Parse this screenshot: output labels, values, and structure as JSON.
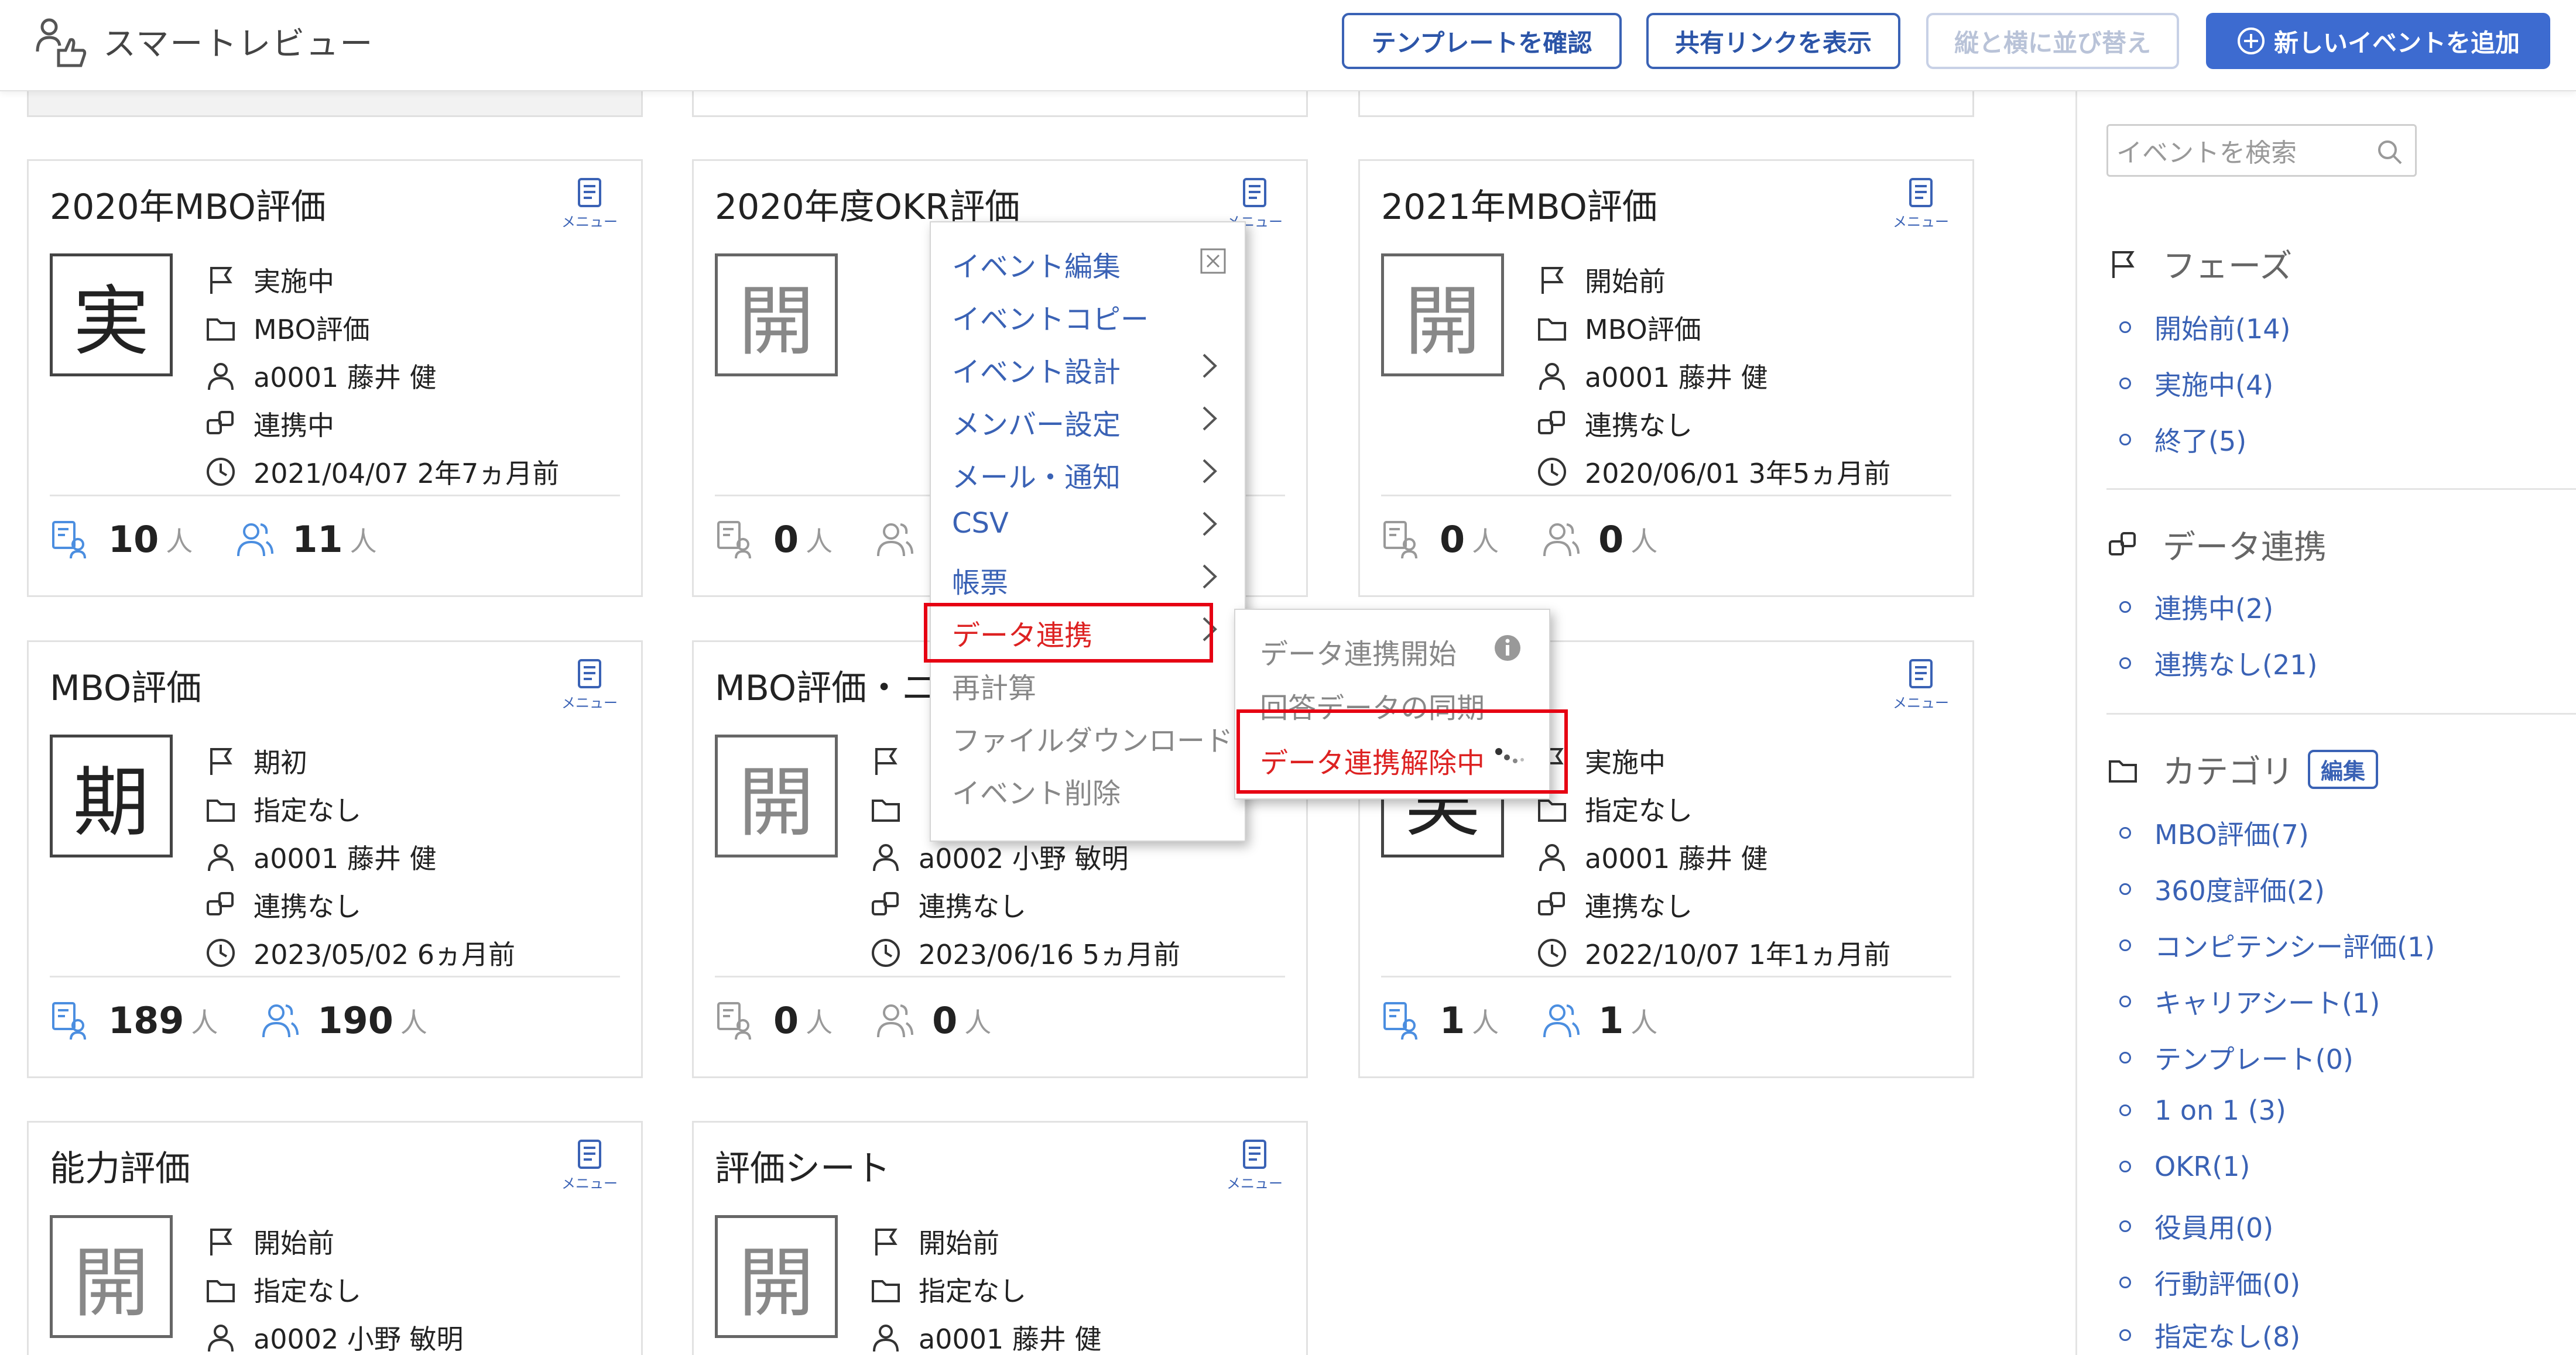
{
  "app": {
    "title": "スマートレビュー"
  },
  "header": {
    "buttons": {
      "template": "テンプレートを確認",
      "share": "共有リンクを表示",
      "sort": "縦と横に並び替え",
      "add": "新しいイベントを追加"
    }
  },
  "cards": [
    {
      "title": "2020年MBO評価",
      "phase_char": "実",
      "phase": "実施中",
      "category": "MBO評価",
      "owner": "a0001 藤井 健",
      "link": "連携中",
      "date": "2021/04/07 2年7ヵ月前",
      "stat1": "10",
      "stat2": "11",
      "unit": "人",
      "menu": "メニュー"
    },
    {
      "title": "2020年度OKR評価",
      "phase_char": "開",
      "phase": "",
      "category": "",
      "owner": "",
      "link": "",
      "date": "",
      "stat1": "0",
      "stat2": "",
      "unit": "人",
      "menu": "メニュー"
    },
    {
      "title": "2021年MBO評価",
      "phase_char": "開",
      "phase": "開始前",
      "category": "MBO評価",
      "owner": "a0001 藤井 健",
      "link": "連携なし",
      "date": "2020/06/01 3年5ヵ月前",
      "stat1": "0",
      "stat2": "0",
      "unit": "人",
      "menu": "メニュー"
    },
    {
      "title": "MBO評価",
      "phase_char": "期",
      "phase": "期初",
      "category": "指定なし",
      "owner": "a0001 藤井 健",
      "link": "連携なし",
      "date": "2023/05/02 6ヵ月前",
      "stat1": "189",
      "stat2": "190",
      "unit": "人",
      "menu": "メニュー"
    },
    {
      "title": "MBO評価・ニ",
      "phase_char": "開",
      "phase": "",
      "category": "",
      "owner": "a0002 小野 敏明",
      "link": "連携なし",
      "date": "2023/06/16 5ヵ月前",
      "stat1": "0",
      "stat2": "0",
      "unit": "人",
      "menu": "メニュー"
    },
    {
      "title": "",
      "phase_char": "実",
      "phase": "実施中",
      "category": "指定なし",
      "owner": "a0001 藤井 健",
      "link": "連携なし",
      "date": "2022/10/07 1年1ヵ月前",
      "stat1": "1",
      "stat2": "1",
      "unit": "人",
      "menu": "メニュー"
    },
    {
      "title": "能力評価",
      "phase_char": "開",
      "phase": "開始前",
      "category": "指定なし",
      "owner": "a0002 小野 敏明",
      "menu": "メニュー"
    },
    {
      "title": "評価シート",
      "phase_char": "開",
      "phase": "開始前",
      "category": "指定なし",
      "owner": "a0001 藤井 健",
      "menu": "メニュー"
    }
  ],
  "context_menu": {
    "items": [
      "イベント編集",
      "イベントコピー",
      "イベント設計",
      "メンバー設定",
      "メール・通知",
      "CSV",
      "帳票",
      "データ連携",
      "再計算",
      "ファイルダウンロード",
      "イベント削除"
    ]
  },
  "submenu": {
    "items": [
      "データ連携開始",
      "回答データの同期",
      "データ連携解除中"
    ]
  },
  "sidebar": {
    "search_placeholder": "イベントを検索",
    "phase": {
      "title": "フェーズ",
      "items": [
        "開始前(14)",
        "実施中(4)",
        "終了(5)"
      ]
    },
    "data_link": {
      "title": "データ連携",
      "items": [
        "連携中(2)",
        "連携なし(21)"
      ]
    },
    "category": {
      "title": "カテゴリ",
      "edit": "編集",
      "items": [
        "MBO評価(7)",
        "360度評価(2)",
        "コンピテンシー評価(1)",
        "キャリアシート(1)",
        "テンプレート(0)",
        "1 on 1 (3)",
        "OKR(1)",
        "役員用(0)",
        "行動評価(0)",
        "指定なし(8)"
      ]
    }
  },
  "colors": {
    "accent": "#3a62b5",
    "primary_button": "#3d6bd0",
    "highlight": "#e60012",
    "danger_text": "#dd2222"
  }
}
